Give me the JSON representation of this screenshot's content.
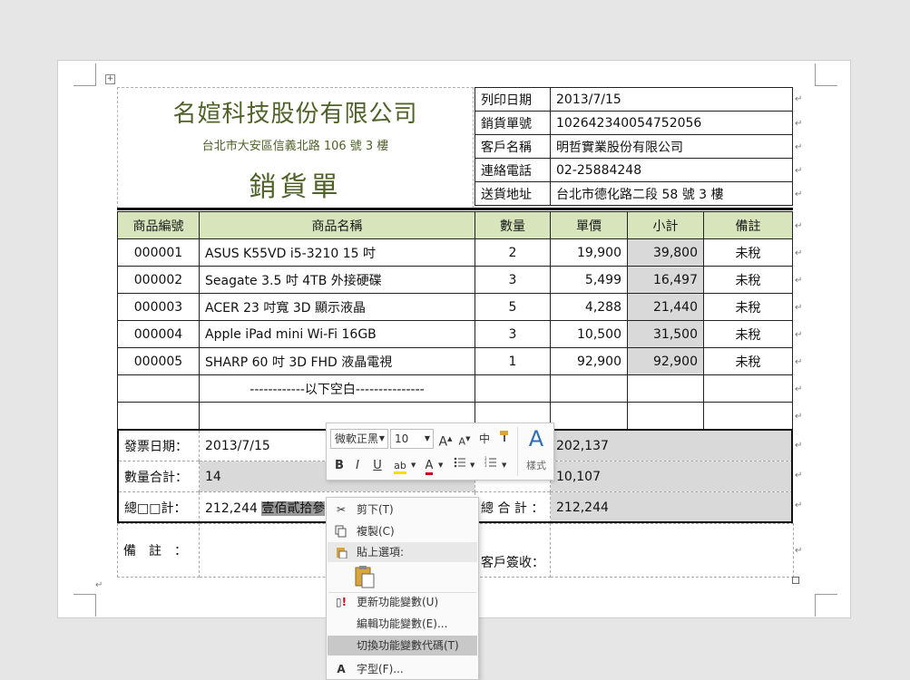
{
  "header": {
    "company": "名媗科技股份有限公司",
    "address": "台北市大安區信義北路 106 號 3 樓",
    "doc_title": "銷貨單"
  },
  "info": [
    {
      "label": "列印日期",
      "value": "2013/7/15"
    },
    {
      "label": "銷貨單號",
      "value": "102642340054752056"
    },
    {
      "label": "客戶名稱",
      "value": "明哲實業股份有限公司"
    },
    {
      "label": "連絡電話",
      "value": "02-25884248"
    },
    {
      "label": "送貨地址",
      "value": "台北市德化路二段 58 號 3 樓"
    }
  ],
  "items": {
    "headers": [
      "商品編號",
      "商品名稱",
      "數量",
      "單價",
      "小計",
      "備註"
    ],
    "rows": [
      [
        "000001",
        "ASUS K55VD i5-3210 15 吋",
        "2",
        "19,900",
        "39,800",
        "未稅"
      ],
      [
        "000002",
        "Seagate 3.5 吋 4TB 外接硬碟",
        "3",
        "5,499",
        "16,497",
        "未稅"
      ],
      [
        "000003",
        "ACER 23 吋寬 3D 顯示液晶",
        "5",
        "4,288",
        "21,440",
        "未稅"
      ],
      [
        "000004",
        "Apple iPad mini Wi-Fi 16GB",
        "3",
        "10,500",
        "31,500",
        "未稅"
      ],
      [
        "000005",
        "SHARP 60 吋 3D FHD 液晶電視",
        "1",
        "92,900",
        "92,900",
        "未稅"
      ]
    ],
    "blank_line": "------------以下空白---------------"
  },
  "summary": {
    "invoice_date_label": "發票日期：",
    "invoice_date": "2013/7/15",
    "qty_total_label": "數量合計：",
    "qty_total": "14",
    "grand_label": "總□□計：",
    "grand_value": "212,244",
    "grand_words": "壹佰貳拾參",
    "r1_value": "202,137",
    "r2_value": "10,107",
    "total_label": "總 合 計 ：",
    "total_value": "212,244"
  },
  "remarks": {
    "label": "備　註　：",
    "sign_label": "客戶簽收："
  },
  "mini_toolbar": {
    "font_name": "微軟正黑",
    "font_size": "10",
    "grow": "A",
    "shrink": "A",
    "phonetic": "中",
    "bold": "B",
    "italic": "I",
    "underline": "U",
    "highlight": "ab",
    "font_color": "A",
    "styles_glyph": "A",
    "styles_label": "樣式"
  },
  "context_menu": {
    "cut": "剪下(T)",
    "copy": "複製(C)",
    "paste_options": "貼上選項:",
    "update_field": "更新功能變數(U)",
    "edit_field": "編輯功能變數(E)...",
    "toggle_codes": "切換功能變數代碼(T)",
    "font": "字型(F)..."
  },
  "colors": {
    "header_text": "#4f6228",
    "table_header_bg": "#d7e4bc",
    "subtotal_bg": "#d9d9d9",
    "menu_highlight": "#c8c8c8"
  }
}
